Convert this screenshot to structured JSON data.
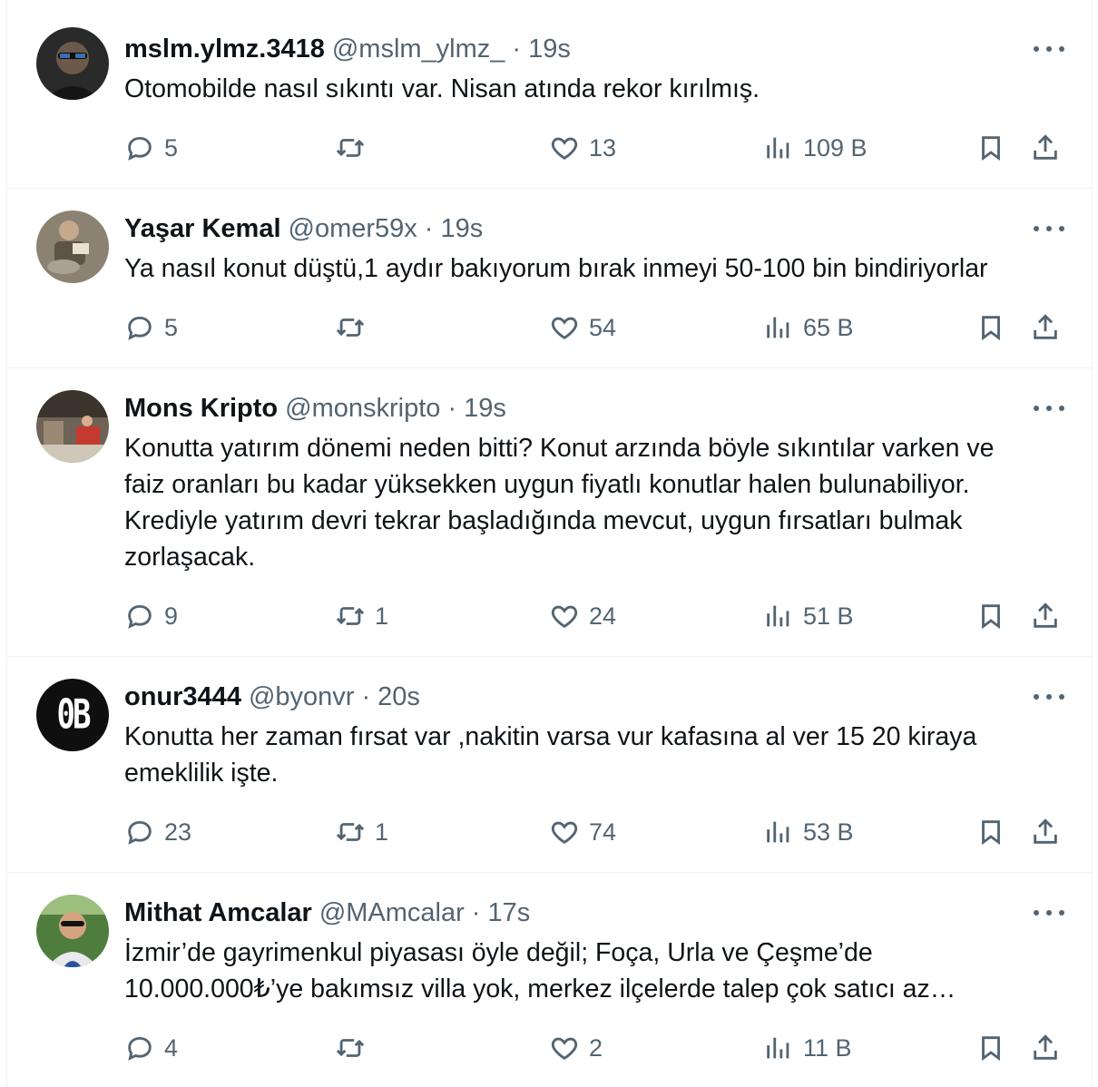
{
  "tweets": [
    {
      "name": "mslm.ylmz.3418",
      "handle": "@mslm_ylmz_",
      "separator": "·",
      "time": "19s",
      "lines": [
        "Otomobilde nasıl sıkıntı var. Nisan atında rekor kırılmış."
      ],
      "replies": "5",
      "retweets": "",
      "likes": "13",
      "views": "109 B"
    },
    {
      "name": "Yaşar Kemal",
      "handle": "@omer59x",
      "separator": "·",
      "time": "19s",
      "lines": [
        "Ya nasıl konut düştü,1 aydır bakıyorum bırak inmeyi 50-100 bin bindiriyorlar"
      ],
      "replies": "5",
      "retweets": "",
      "likes": "54",
      "views": "65 B"
    },
    {
      "name": "Mons Kripto",
      "handle": "@monskripto",
      "separator": "·",
      "time": "19s",
      "lines": [
        "Konutta yatırım dönemi neden bitti? Konut arzında böyle sıkıntılar varken ve",
        "faiz oranları bu kadar yüksekken uygun fiyatlı konutlar halen bulunabiliyor.",
        "Krediyle yatırım devri tekrar başladığında mevcut, uygun fırsatları bulmak",
        "zorlaşacak."
      ],
      "replies": "9",
      "retweets": "1",
      "likes": "24",
      "views": "51 B"
    },
    {
      "name": "onur3444",
      "handle": "@byonvr",
      "separator": "·",
      "time": "20s",
      "avatar_text": "0B",
      "lines": [
        "Konutta her zaman fırsat var ,nakitin varsa vur kafasına al ver 15 20 kiraya",
        "emeklilik işte."
      ],
      "replies": "23",
      "retweets": "1",
      "likes": "74",
      "views": "53 B"
    },
    {
      "name": "Mithat Amcalar",
      "handle": "@MAmcalar",
      "separator": "·",
      "time": "17s",
      "lines": [
        "İzmir’de gayrimenkul piyasası öyle değil;  Foça, Urla ve Çeşme’de",
        "10.000.000₺’ye bakımsız villa yok, merkez ilçelerde talep çok satıcı az…"
      ],
      "replies": "4",
      "retweets": "",
      "likes": "2",
      "views": "11 B"
    }
  ],
  "icons": {
    "reply": "speech-bubble-icon",
    "retweet": "retweet-arrows-icon",
    "like": "heart-icon",
    "views": "bar-chart-icon",
    "bookmark": "bookmark-icon",
    "share": "share-upload-icon",
    "more": "three-dots-icon"
  },
  "colors": {
    "text": "#0f1419",
    "secondary": "#536471",
    "border": "#eff3f4"
  }
}
